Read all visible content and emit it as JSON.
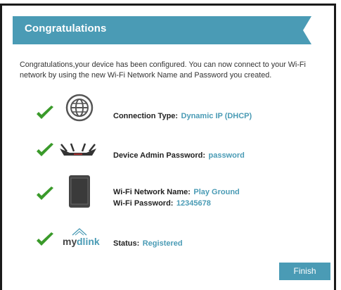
{
  "banner": {
    "title": "Congratulations",
    "color": "#4a9bb5"
  },
  "message": "Congratulations,your device has been configured. You can now connect to your Wi-Fi network by using the new Wi-Fi Network Name and Password you created.",
  "items": [
    {
      "icon": "globe-icon",
      "label": "Connection Type:",
      "value": "Dynamic IP (DHCP)"
    },
    {
      "icon": "router-icon",
      "label": "Device Admin Password:",
      "value": "password"
    },
    {
      "icon": "tablet-icon",
      "wifi_name_label": "Wi-Fi Network Name:",
      "wifi_name_value": "Play Ground",
      "wifi_password_label": "Wi-Fi Password:",
      "wifi_password_value": "12345678"
    },
    {
      "icon": "mydlink-logo",
      "logo_text": "mydlink",
      "label": "Status:",
      "value": "Registered"
    }
  ],
  "finish_button": {
    "label": "Finish"
  },
  "colors": {
    "accent": "#4a9bb5",
    "check": "#3a9a2a"
  }
}
